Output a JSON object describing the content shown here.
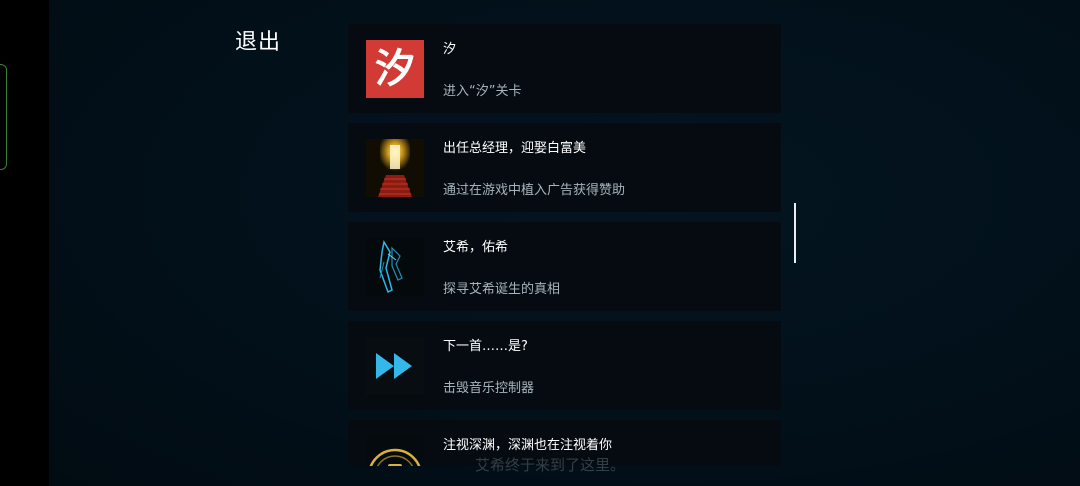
{
  "header": {
    "exit_label": "退出"
  },
  "achievements": [
    {
      "title": "汐",
      "description": "进入“汐”关卡",
      "icon": "xi-character-icon",
      "icon_glyph": "汐"
    },
    {
      "title": "出任总经理，迎娶白富美",
      "description": "通过在游戏中植入广告获得赞助",
      "icon": "golden-stairway-icon"
    },
    {
      "title": "艾希，佑希",
      "description": "探寻艾希诞生的真相",
      "icon": "blue-blade-icon"
    },
    {
      "title": "下一首……是?",
      "description": "击毁音乐控制器",
      "icon": "fast-forward-icon"
    },
    {
      "title": "注视深渊，深渊也在注视着你",
      "description": "",
      "icon": "abyss-eye-icon"
    }
  ],
  "subtitle": "艾希终于来到了这里。",
  "colors": {
    "accent_cyan": "#2bb8e6",
    "xi_red": "#d13a35",
    "gold": "#d9b23a"
  }
}
